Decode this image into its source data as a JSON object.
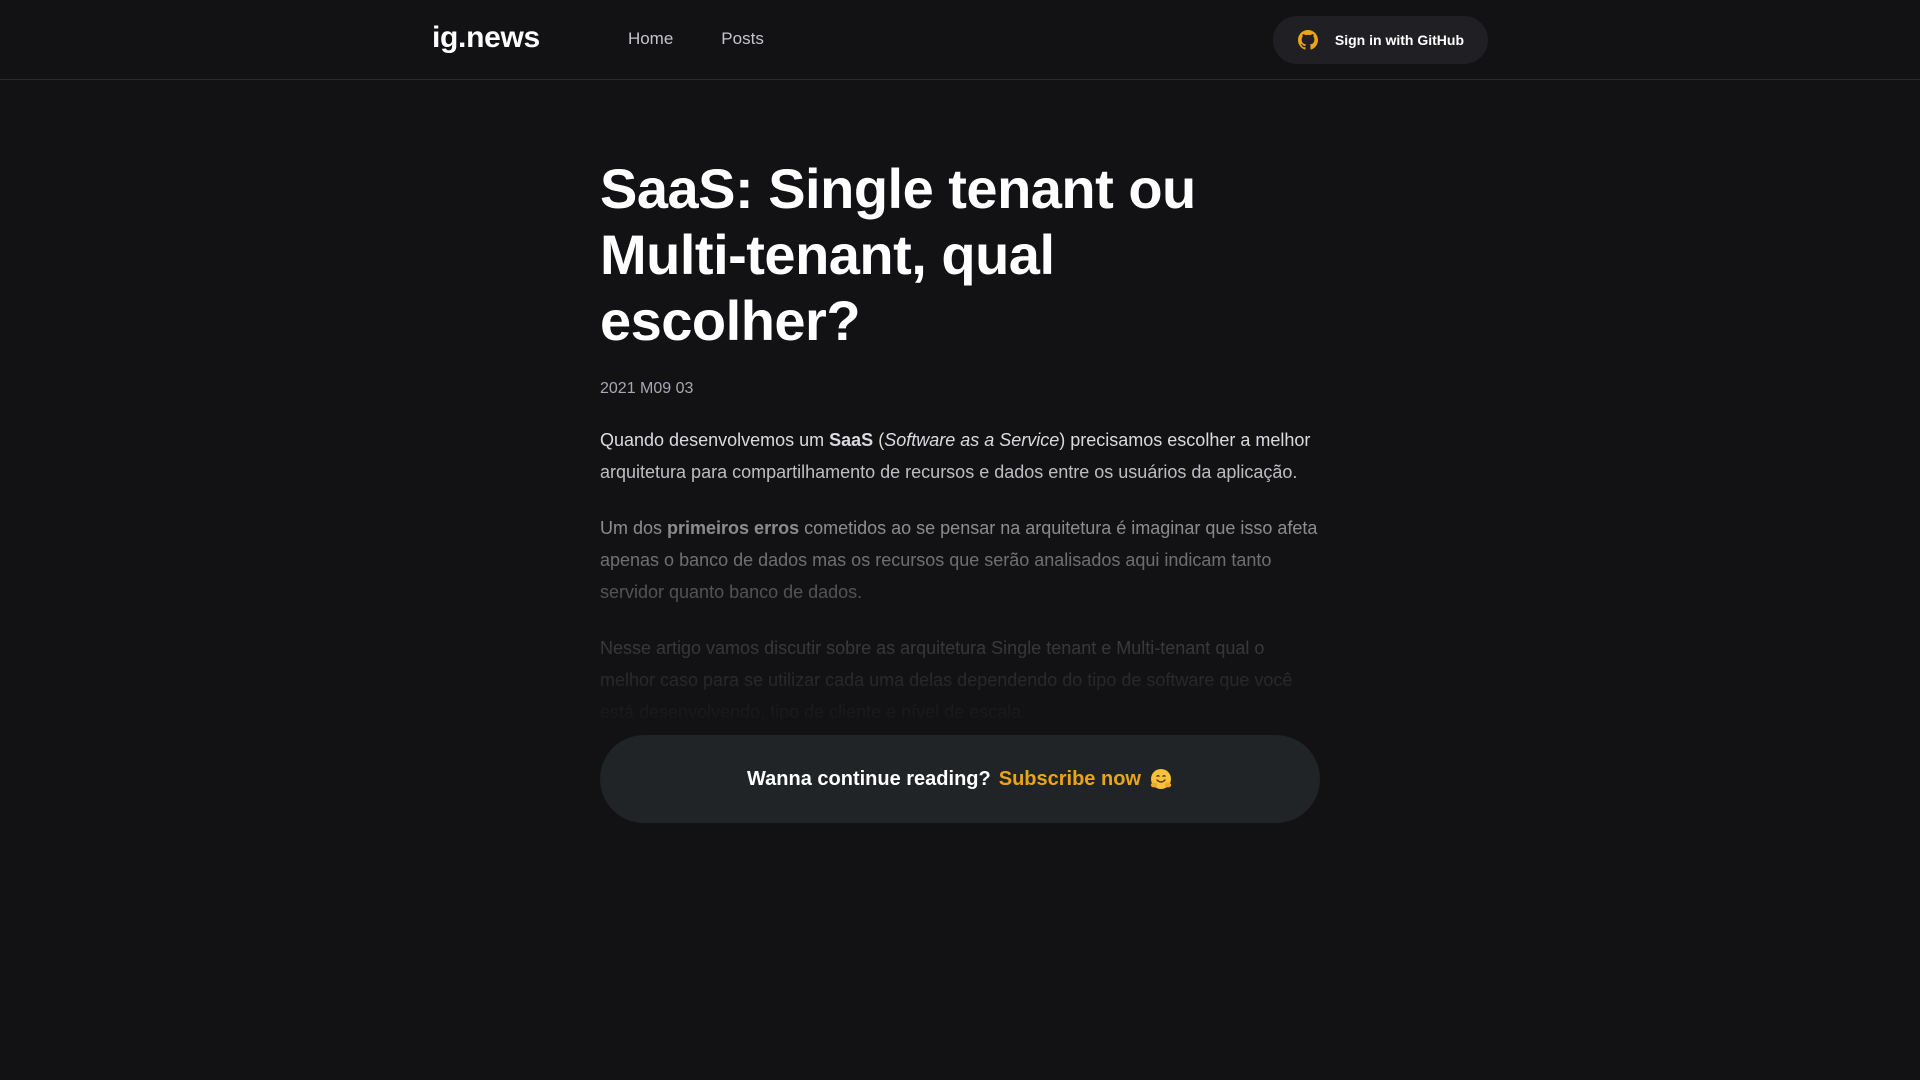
{
  "header": {
    "logo": "ig.news",
    "nav": [
      {
        "label": "Home"
      },
      {
        "label": "Posts"
      }
    ],
    "signin_label": "Sign in with GitHub",
    "signin_icon": "github-icon",
    "accent_color": "#eba417"
  },
  "article": {
    "title": "SaaS: Single tenant ou Multi-tenant, qual escolher?",
    "date": "2021 M09 03",
    "p1": {
      "t1": "Quando desenvolvemos um ",
      "b1": "SaaS",
      "t2": " (",
      "i1": "Software as a Service",
      "t3": ") precisamos escolher a melhor arquitetura para compartilhamento de recursos e dados entre os usuários da aplicação."
    },
    "p2": {
      "t1": "Um dos ",
      "b1": "primeiros erros",
      "t2": " cometidos ao se pensar na arquitetura é imaginar que isso afeta apenas o banco de dados mas os recursos que serão analisados aqui indicam tanto servidor quanto banco de dados."
    },
    "p3": "Nesse artigo vamos discutir sobre as arquitetura Single tenant e Multi-tenant qual o melhor caso para se utilizar cada uma delas dependendo do tipo de software que você está desenvolvendo, tipo de cliente e nível de escala."
  },
  "cta": {
    "text": "Wanna continue reading?",
    "link": "Subscribe now",
    "emoji_icon": "hugging-face-icon"
  }
}
